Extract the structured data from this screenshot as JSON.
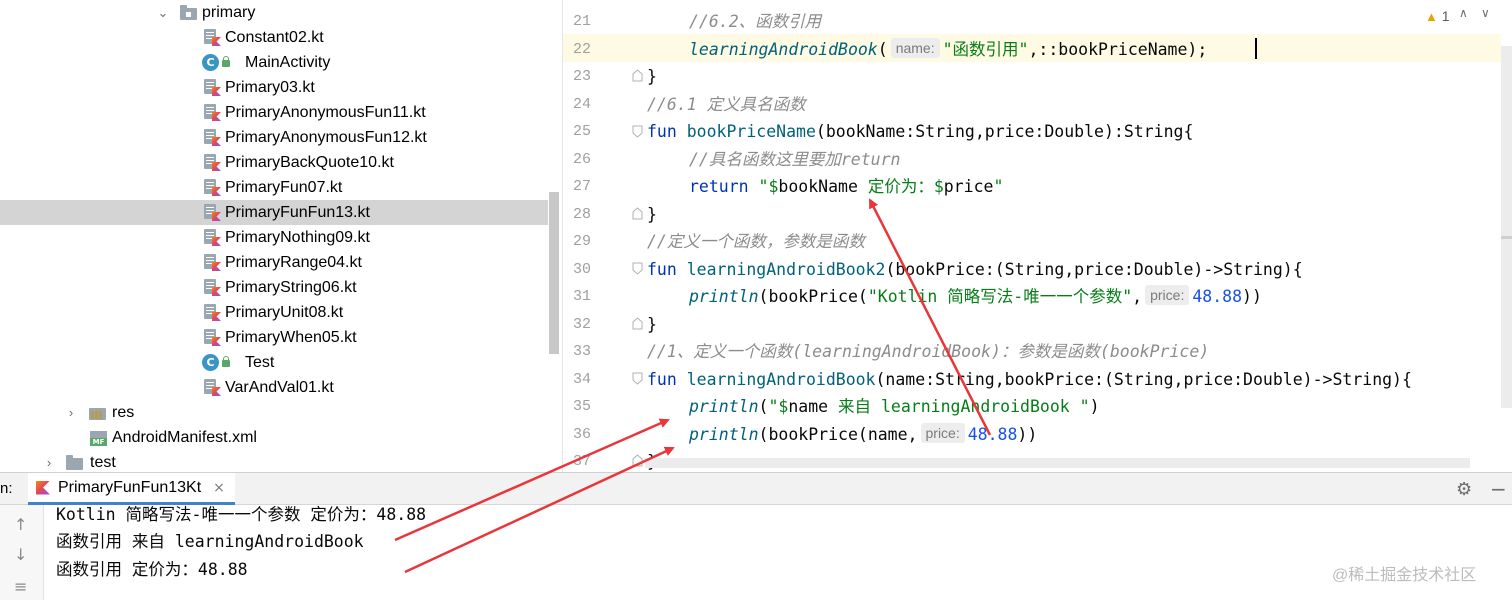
{
  "project_tree": {
    "folder_primary": "primary",
    "files": [
      {
        "label": "Constant02.kt",
        "type": "kotlin-file-icon"
      },
      {
        "label": "MainActivity",
        "type": "class-icon"
      },
      {
        "label": "Primary03.kt",
        "type": "kotlin-file-icon"
      },
      {
        "label": "PrimaryAnonymousFun11.kt",
        "type": "kotlin-file-icon"
      },
      {
        "label": "PrimaryAnonymousFun12.kt",
        "type": "kotlin-file-icon"
      },
      {
        "label": "PrimaryBackQuote10.kt",
        "type": "kotlin-file-icon"
      },
      {
        "label": "PrimaryFun07.kt",
        "type": "kotlin-file-icon"
      },
      {
        "label": "PrimaryFunFun13.kt",
        "type": "kotlin-file-icon",
        "selected": true
      },
      {
        "label": "PrimaryNothing09.kt",
        "type": "kotlin-file-icon"
      },
      {
        "label": "PrimaryRange04.kt",
        "type": "kotlin-file-icon"
      },
      {
        "label": "PrimaryString06.kt",
        "type": "kotlin-file-icon"
      },
      {
        "label": "PrimaryUnit08.kt",
        "type": "kotlin-file-icon"
      },
      {
        "label": "PrimaryWhen05.kt",
        "type": "kotlin-file-icon"
      },
      {
        "label": "Test",
        "type": "class-icon"
      },
      {
        "label": "VarAndVal01.kt",
        "type": "kotlin-file-icon"
      }
    ],
    "folder_res": "res",
    "manifest": "AndroidManifest.xml",
    "manifest_icon_text": "MF",
    "folder_test": "test"
  },
  "editor": {
    "warning_count": "1",
    "line_numbers": [
      "21",
      "22",
      "23",
      "24",
      "25",
      "26",
      "27",
      "28",
      "29",
      "30",
      "31",
      "32",
      "33",
      "34",
      "35",
      "36",
      "37"
    ],
    "code": {
      "l21_comment": "//6.2、函数引用",
      "l22_fn": "learningAndroidBook",
      "l22_hint": "name:",
      "l22_str": "\"函数引用\"",
      "l22_ref": ",::bookPriceName);",
      "l23": "}",
      "l24_comment": "//6.1 定义具名函数",
      "l25_kw": "fun",
      "l25_fn": "bookPriceName",
      "l25_rest": "(bookName:String,price:Double):String{",
      "l26_comment": "//具名函数这里要加return",
      "l27_kw": "return",
      "l27_q1": "\"$",
      "l27_v1": "bookName",
      "l27_mid": " 定价为：$",
      "l27_v2": "price",
      "l27_q2": "\"",
      "l28": "}",
      "l29_comment": "//定义一个函数，参数是函数",
      "l30_kw": "fun",
      "l30_fn": "learningAndroidBook2",
      "l30_rest": "(bookPrice:(String,price:Double)->String){",
      "l31_fn": "println",
      "l31_a": "(bookPrice(",
      "l31_str": "\"Kotlin 简略写法-唯一一个参数\"",
      "l31_comma": ",",
      "l31_hint": "price:",
      "l31_num": "48.88",
      "l31_end": "))",
      "l32": "}",
      "l33_comment": "//1、定义一个函数(learningAndroidBook)：参数是函数(bookPrice)",
      "l34_kw": "fun",
      "l34_fn": "learningAndroidBook",
      "l34_rest": "(name:String,bookPrice:(String,price:Double)->String){",
      "l35_fn": "println",
      "l35_a": "(",
      "l35_q1": "\"$",
      "l35_v": "name",
      "l35_str": " 来自 learningAndroidBook \"",
      "l35_end": ")",
      "l36_fn": "println",
      "l36_a": "(bookPrice(name,",
      "l36_hint": "price:",
      "l36_num": "48.88",
      "l36_end": "))",
      "l37": "}"
    }
  },
  "run_panel": {
    "label": "n:",
    "tab_title": "PrimaryFunFun13Kt",
    "tab_close": "×",
    "output": [
      "Kotlin 简略写法-唯一一个参数 定价为：48.88",
      "函数引用 来自 learningAndroidBook",
      "函数引用 定价为：48.88"
    ],
    "watermark": "@稀土掘金技术社区"
  },
  "colors": {
    "keyword": "#0033b3",
    "function": "#00627a",
    "string": "#067d17",
    "number": "#1750eb",
    "comment": "#8c8c8c",
    "selection": "#d4d4d4",
    "caret_line": "#fffae3",
    "arrow": "#e8363a",
    "tab_underline": "#4083c9"
  }
}
